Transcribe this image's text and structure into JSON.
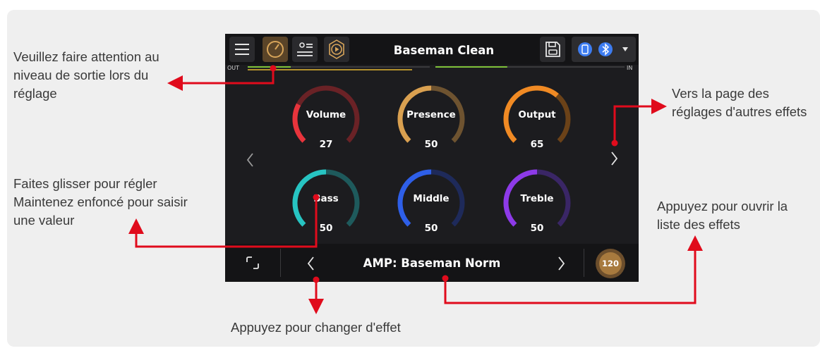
{
  "annotations": {
    "output_level": [
      "Veuillez faire attention au",
      "niveau de sortie lors du",
      "réglage"
    ],
    "other_effects": [
      "Vers la page des",
      "réglages d'autres effets"
    ],
    "drag_adjust": [
      "Faites glisser pour régler",
      "Maintenez enfoncé pour saisir",
      "une valeur"
    ],
    "open_list": [
      "Appuyez pour ouvrir la",
      "liste des effets"
    ],
    "change_effect": [
      "Appuyez pour changer d'effet"
    ]
  },
  "device": {
    "preset_name": "Baseman Clean",
    "meter_out_label": "OUT",
    "meter_in_label": "IN",
    "meter_out_level": 0.43,
    "meter_in_level": 0.38,
    "icons": {
      "menu": "menu-icon",
      "amp": "amp-knob-icon",
      "list": "list-icon",
      "play": "play-icon",
      "save": "save-icon",
      "phone": "phone-icon",
      "bluetooth": "bluetooth-icon",
      "dropdown": "caret-down-icon",
      "fullscreen": "fullscreen-icon"
    },
    "knobs": [
      {
        "label": "Volume",
        "value": "27",
        "color": "#e8343c",
        "track": "#6a2226"
      },
      {
        "label": "Presence",
        "value": "50",
        "color": "#d9a050",
        "track": "#6e5330"
      },
      {
        "label": "Output",
        "value": "65",
        "color": "#f08a24",
        "track": "#6b4218"
      },
      {
        "label": "Bass",
        "value": "50",
        "color": "#27c4c2",
        "track": "#1e5a5c"
      },
      {
        "label": "Middle",
        "value": "50",
        "color": "#2e5fe8",
        "track": "#1e2a5a"
      },
      {
        "label": "Treble",
        "value": "50",
        "color": "#8d3ae8",
        "track": "#3a2666"
      }
    ],
    "effect_name": "AMP: Baseman Norm",
    "bpm": "120"
  },
  "colors": {
    "callout_red": "#e00b1c",
    "accent_gold": "#b8843f"
  }
}
